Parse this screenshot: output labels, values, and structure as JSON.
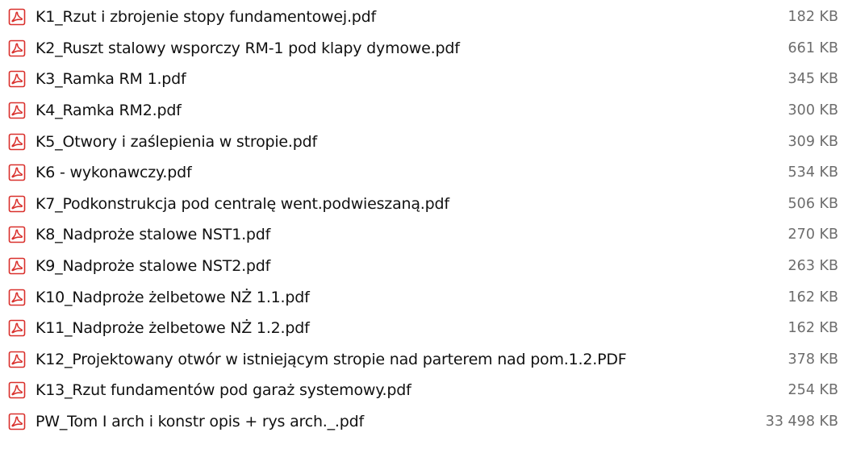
{
  "colors": {
    "pdf_icon_red": "#d9302c",
    "size_text": "#6d6d6d",
    "name_text": "#111111"
  },
  "files": [
    {
      "name": "K1_Rzut i zbrojenie stopy fundamentowej.pdf",
      "size": "182 KB",
      "icon": "pdf-icon"
    },
    {
      "name": "K2_Ruszt stalowy wsporczy RM-1 pod klapy dymowe.pdf",
      "size": "661 KB",
      "icon": "pdf-icon"
    },
    {
      "name": "K3_Ramka RM 1.pdf",
      "size": "345 KB",
      "icon": "pdf-icon"
    },
    {
      "name": "K4_Ramka RM2.pdf",
      "size": "300 KB",
      "icon": "pdf-icon"
    },
    {
      "name": "K5_Otwory i zaślepienia w stropie.pdf",
      "size": "309 KB",
      "icon": "pdf-icon"
    },
    {
      "name": "K6 - wykonawczy.pdf",
      "size": "534 KB",
      "icon": "pdf-icon"
    },
    {
      "name": "K7_Podkonstrukcja pod centralę went.podwieszaną.pdf",
      "size": "506 KB",
      "icon": "pdf-icon"
    },
    {
      "name": "K8_Nadproże stalowe NST1.pdf",
      "size": "270 KB",
      "icon": "pdf-icon"
    },
    {
      "name": "K9_Nadproże stalowe NST2.pdf",
      "size": "263 KB",
      "icon": "pdf-icon"
    },
    {
      "name": "K10_Nadproże żelbetowe NŻ 1.1.pdf",
      "size": "162 KB",
      "icon": "pdf-icon"
    },
    {
      "name": "K11_Nadproże żelbetowe NŻ 1.2.pdf",
      "size": "162 KB",
      "icon": "pdf-icon"
    },
    {
      "name": "K12_Projektowany otwór w istniejącym stropie nad parterem nad pom.1.2.PDF",
      "size": "378 KB",
      "icon": "pdf-icon"
    },
    {
      "name": "K13_Rzut fundamentów pod garaż systemowy.pdf",
      "size": "254 KB",
      "icon": "pdf-icon"
    },
    {
      "name": "PW_Tom I arch i konstr opis + rys arch._.pdf",
      "size": "33 498 KB",
      "icon": "pdf-icon"
    }
  ]
}
